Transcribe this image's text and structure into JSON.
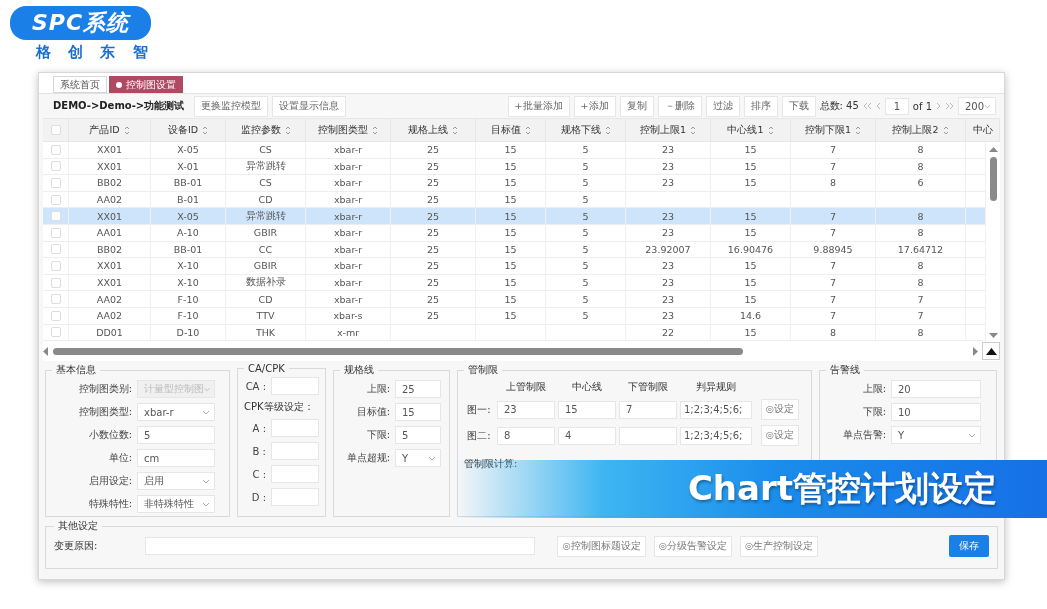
{
  "brand": {
    "logo": "SPC系统",
    "subtitle": "格 创 东 智"
  },
  "tabs": [
    {
      "label": "系统首页",
      "selected": false
    },
    {
      "label": "控制图设置",
      "selected": true
    }
  ],
  "toolbar": {
    "breadcrumb": "DEMO->Demo->功能测试",
    "left_buttons": [
      "更换监控模型",
      "设置显示信息"
    ],
    "right_buttons": [
      "+批量添加",
      "+添加",
      "复制",
      "－删除",
      "过滤",
      "排序",
      "下载"
    ],
    "total": "总数: 45",
    "page": "1",
    "page_of": "of 1",
    "page_size": "200"
  },
  "table": {
    "all_checked": false,
    "columns": [
      "产品ID",
      "设备ID",
      "监控参数",
      "控制图类型",
      "规格上线",
      "目标值",
      "规格下线",
      "控制上限1",
      "中心线1",
      "控制下限1",
      "控制上限2",
      "中心"
    ],
    "rows": [
      {
        "selected": false,
        "checked": false,
        "cells": [
          "XX01",
          "X-05",
          "CS",
          "xbar-r",
          "25",
          "15",
          "5",
          "23",
          "15",
          "7",
          "8"
        ]
      },
      {
        "selected": false,
        "checked": false,
        "cells": [
          "XX01",
          "X-01",
          "异常跳转",
          "xbar-r",
          "25",
          "15",
          "5",
          "23",
          "15",
          "7",
          "8"
        ]
      },
      {
        "selected": false,
        "checked": false,
        "cells": [
          "BB02",
          "BB-01",
          "CS",
          "xbar-r",
          "25",
          "15",
          "5",
          "23",
          "15",
          "8",
          "6"
        ]
      },
      {
        "selected": false,
        "checked": false,
        "cells": [
          "AA02",
          "B-01",
          "CD",
          "xbar-r",
          "25",
          "15",
          "5",
          null,
          null,
          null,
          null
        ]
      },
      {
        "selected": true,
        "checked": false,
        "cells": [
          "XX01",
          "X-05",
          "异常跳转",
          "xbar-r",
          "25",
          "15",
          "5",
          "23",
          "15",
          "7",
          "8"
        ]
      },
      {
        "selected": false,
        "checked": false,
        "cells": [
          "AA01",
          "A-10",
          "GBIR",
          "xbar-r",
          "25",
          "15",
          "5",
          "23",
          "15",
          "7",
          "8"
        ]
      },
      {
        "selected": false,
        "checked": false,
        "cells": [
          "BB02",
          "BB-01",
          "CC",
          "xbar-r",
          "25",
          "15",
          "5",
          "23.92007",
          "16.90476",
          "9.88945",
          "17.64712"
        ]
      },
      {
        "selected": false,
        "checked": false,
        "cells": [
          "XX01",
          "X-10",
          "GBIR",
          "xbar-r",
          "25",
          "15",
          "5",
          "23",
          "15",
          "7",
          "8"
        ]
      },
      {
        "selected": false,
        "checked": false,
        "cells": [
          "XX01",
          "X-10",
          "数据补录",
          "xbar-r",
          "25",
          "15",
          "5",
          "23",
          "15",
          "7",
          "8"
        ]
      },
      {
        "selected": false,
        "checked": false,
        "cells": [
          "AA02",
          "F-10",
          "CD",
          "xbar-r",
          "25",
          "15",
          "5",
          "23",
          "15",
          "7",
          "7"
        ]
      },
      {
        "selected": false,
        "checked": false,
        "cells": [
          "AA02",
          "F-10",
          "TTV",
          "xbar-s",
          "25",
          "15",
          "5",
          "23",
          "14.6",
          "7",
          "7"
        ]
      },
      {
        "selected": false,
        "checked": false,
        "cells": [
          "DD01",
          "D-10",
          "THK",
          "x-mr",
          null,
          null,
          null,
          "22",
          "15",
          "8",
          "8"
        ]
      }
    ]
  },
  "basic_info": {
    "title": "基本信息",
    "fields": [
      {
        "label": "控制图类别:",
        "value": "计量型控制图",
        "kind": "select",
        "disabled": true
      },
      {
        "label": "控制图类型:",
        "value": "xbar-r",
        "kind": "select",
        "disabled": false
      },
      {
        "label": "小数位数:",
        "value": "5",
        "kind": "input",
        "disabled": false
      },
      {
        "label": "单位:",
        "value": "cm",
        "kind": "input",
        "disabled": false
      },
      {
        "label": "启用设定:",
        "value": "启用",
        "kind": "select",
        "disabled": false
      },
      {
        "label": "特殊特性:",
        "value": "非特殊特性",
        "kind": "select",
        "disabled": false
      }
    ]
  },
  "capability": {
    "title": "CA/CPK",
    "ca_label": "CA :",
    "grade_label": "CPK等级设定：",
    "grades": [
      "A :",
      "B :",
      "C :",
      "D :"
    ]
  },
  "spec_lines": {
    "title": "规格线",
    "fields": [
      {
        "label": "上限:",
        "value": "25",
        "kind": "input"
      },
      {
        "label": "目标值:",
        "value": "15",
        "kind": "input"
      },
      {
        "label": "下限:",
        "value": "5",
        "kind": "input"
      },
      {
        "label": "单点超规:",
        "value": "Y",
        "kind": "select"
      }
    ]
  },
  "control_limits": {
    "title": "管制限",
    "columns": [
      "上管制限",
      "中心线",
      "下管制限",
      "判异规则"
    ],
    "rows": [
      {
        "label": "图一:",
        "values": [
          "23",
          "15",
          "7"
        ],
        "rule": "1;2;3;4;5;6;",
        "button": "◎设定"
      },
      {
        "label": "图二:",
        "values": [
          "8",
          "4"
        ],
        "rule": "1;2;3;4;5;6;",
        "button": "◎设定"
      }
    ],
    "calc_label": "管制限计算:"
  },
  "alarm_lines": {
    "title": "告警线",
    "fields": [
      {
        "label": "上限:",
        "value": "20",
        "kind": "input"
      },
      {
        "label": "下限:",
        "value": "10",
        "kind": "input"
      },
      {
        "label": "单点告警:",
        "value": "Y",
        "kind": "select"
      }
    ]
  },
  "other": {
    "title": "其他设定",
    "reason_label": "变更原因:",
    "buttons": [
      "◎控制图标题设定",
      "◎分级告警设定",
      "◎生产控制设定"
    ],
    "save": "保存"
  },
  "banner": "Chart管控计划设定"
}
